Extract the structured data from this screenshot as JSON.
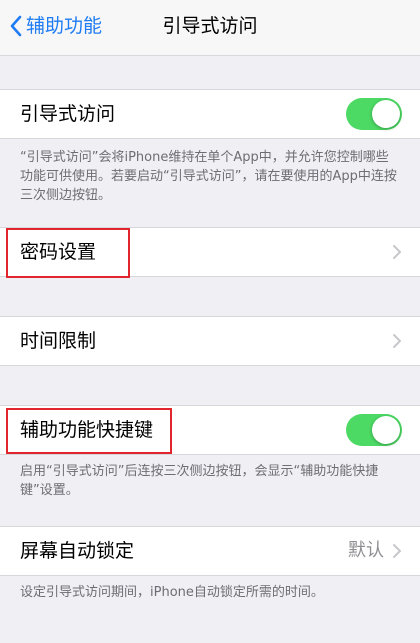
{
  "nav": {
    "back_label": "辅助功能",
    "title": "引导式访问"
  },
  "guided_access": {
    "label": "引导式访问",
    "toggle_on": true,
    "footnote": "“引导式访问”会将iPhone维持在单个App中，并允许您控制哪些功能可供使用。若要启动“引导式访问”，请在要使用的App中连按三次侧边按钮。"
  },
  "passcode_settings": {
    "label": "密码设置"
  },
  "time_limits": {
    "label": "时间限制"
  },
  "accessibility_shortcut": {
    "label": "辅助功能快捷键",
    "toggle_on": true,
    "footnote": "启用“引导式访问”后连按三次侧边按钮，会显示“辅助功能快捷键”设置。"
  },
  "auto_lock": {
    "label": "屏幕自动锁定",
    "value": "默认",
    "footnote": "设定引导式访问期间，iPhone自动锁定所需的时间。"
  },
  "colors": {
    "accent": "#1f7cf3",
    "toggle_on": "#4cd964",
    "highlight": "#e0262c"
  }
}
